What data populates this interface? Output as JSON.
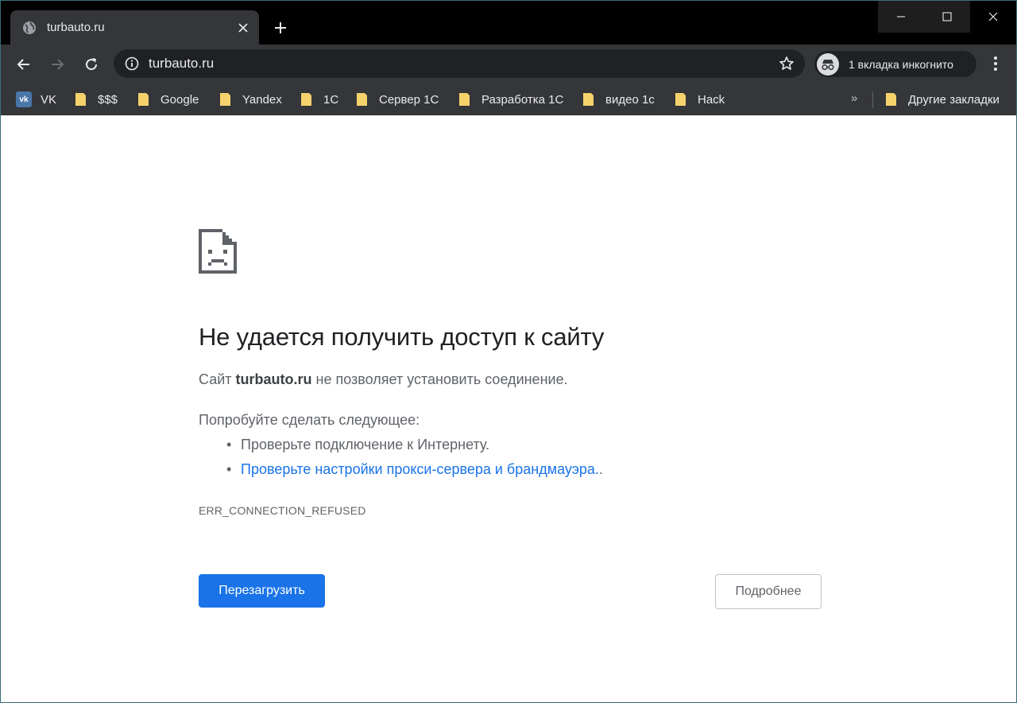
{
  "tab": {
    "title": "turbauto.ru",
    "favicon": "globe-icon"
  },
  "window_controls": [
    "minimize-icon",
    "maximize-icon",
    "close-icon"
  ],
  "toolbar": {
    "url": "turbauto.ru",
    "incognito_label": "1 вкладка инкогнито"
  },
  "bookmarks": {
    "items": [
      {
        "label": "VK",
        "icon": "vk-icon"
      },
      {
        "label": "$$$",
        "icon": "folder-icon"
      },
      {
        "label": "Google",
        "icon": "folder-icon"
      },
      {
        "label": "Yandex",
        "icon": "folder-icon"
      },
      {
        "label": "1С",
        "icon": "folder-icon"
      },
      {
        "label": "Сервер 1С",
        "icon": "folder-icon"
      },
      {
        "label": "Разработка 1С",
        "icon": "folder-icon"
      },
      {
        "label": "видео 1с",
        "icon": "folder-icon"
      },
      {
        "label": "Hack",
        "icon": "folder-icon"
      }
    ],
    "overflow": "»",
    "other_label": "Другие закладки"
  },
  "error": {
    "heading": "Не удается получить доступ к сайту",
    "site_prefix": "Сайт",
    "site": "turbauto.ru",
    "site_suffix": "не позволяет установить соединение.",
    "try_label": "Попробуйте сделать следующее:",
    "suggestions": [
      "Проверьте подключение к Интернету.",
      "Проверьте настройки прокси-сервера и брандмауэра."
    ],
    "suggestion_suffix": ".",
    "code": "ERR_CONNECTION_REFUSED",
    "reload_label": "Перезагрузить",
    "details_label": "Подробнее"
  },
  "colors": {
    "accent": "#1a73e8",
    "chrome_dark": "#35363a",
    "omnibox": "#202124"
  }
}
